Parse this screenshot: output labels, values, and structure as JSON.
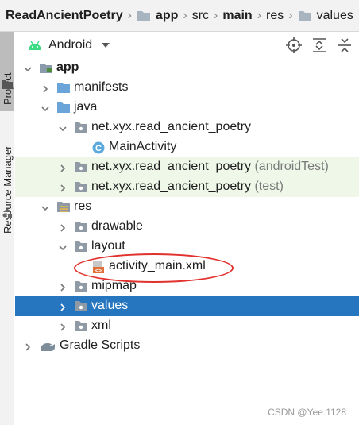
{
  "breadcrumb": {
    "items": [
      {
        "label": "ReadAncientPoetry",
        "bold": true
      },
      {
        "label": "app",
        "bold": true
      },
      {
        "label": "src",
        "bold": false
      },
      {
        "label": "main",
        "bold": true
      },
      {
        "label": "res",
        "bold": false
      },
      {
        "label": "values",
        "bold": false
      }
    ]
  },
  "side_strip": {
    "project_tab": "Project",
    "resource_manager_tab": "Resource Manager"
  },
  "toolbar": {
    "view_mode": "Android",
    "icons": [
      "locate-icon",
      "expand-all-icon",
      "collapse-all-icon"
    ]
  },
  "tree": [
    {
      "id": "app",
      "label": "app",
      "bold": true,
      "level": 0,
      "chevron": "down",
      "icon": "module"
    },
    {
      "id": "manifests",
      "label": "manifests",
      "level": 1,
      "chevron": "right",
      "icon": "folder-blue"
    },
    {
      "id": "java",
      "label": "java",
      "level": 1,
      "chevron": "down",
      "icon": "folder-blue"
    },
    {
      "id": "pkg-main",
      "label": "net.xyx.read_ancient_poetry",
      "level": 2,
      "chevron": "down",
      "icon": "package"
    },
    {
      "id": "main-activity",
      "label": "MainActivity",
      "level": 3,
      "chevron": "none",
      "icon": "class"
    },
    {
      "id": "pkg-android-test",
      "label": "net.xyx.read_ancient_poetry",
      "suffix": "(androidTest)",
      "level": 2,
      "chevron": "right",
      "icon": "package",
      "tint": true
    },
    {
      "id": "pkg-test",
      "label": "net.xyx.read_ancient_poetry",
      "suffix": "(test)",
      "level": 2,
      "chevron": "right",
      "icon": "package",
      "tint": true
    },
    {
      "id": "res",
      "label": "res",
      "level": 1,
      "chevron": "down",
      "icon": "res-folder"
    },
    {
      "id": "drawable",
      "label": "drawable",
      "level": 2,
      "chevron": "right",
      "icon": "package"
    },
    {
      "id": "layout",
      "label": "layout",
      "level": 2,
      "chevron": "down",
      "icon": "package"
    },
    {
      "id": "activity-main-xml",
      "label": "activity_main.xml",
      "level": 3,
      "chevron": "none",
      "icon": "xml-layout"
    },
    {
      "id": "mipmap",
      "label": "mipmap",
      "level": 2,
      "chevron": "right",
      "icon": "package"
    },
    {
      "id": "values",
      "label": "values",
      "level": 2,
      "chevron": "right",
      "icon": "package",
      "selected": true
    },
    {
      "id": "xml",
      "label": "xml",
      "level": 2,
      "chevron": "right",
      "icon": "package"
    },
    {
      "id": "gradle-scripts",
      "label": "Gradle Scripts",
      "level": 0,
      "chevron": "right",
      "icon": "gradle"
    }
  ],
  "colors": {
    "selection": "#2675bf",
    "test_tint": "#eef7e8",
    "highlight_ellipse": "#e1322e",
    "android_green": "#3ddc84"
  },
  "watermark": "CSDN @Yee.1128"
}
